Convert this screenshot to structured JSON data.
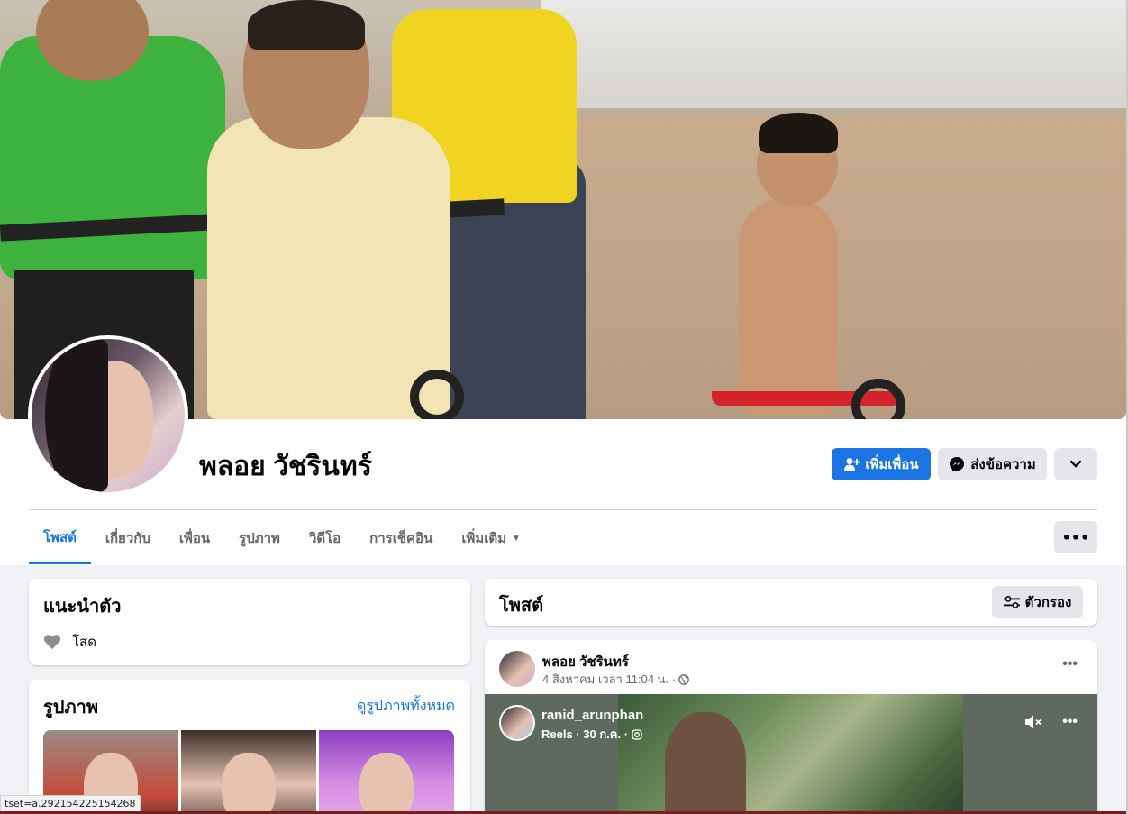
{
  "profile": {
    "name": "พลอย วัชรินทร์"
  },
  "actions": {
    "add_friend": "เพิ่มเพื่อน",
    "message": "ส่งข้อความ"
  },
  "tabs": [
    {
      "label": "โพสต์",
      "active": true
    },
    {
      "label": "เกี่ยวกับ"
    },
    {
      "label": "เพื่อน"
    },
    {
      "label": "รูปภาพ"
    },
    {
      "label": "วิดีโอ"
    },
    {
      "label": "การเช็คอิน"
    },
    {
      "label": "เพิ่มเติม"
    }
  ],
  "intro": {
    "title": "แนะนำตัว",
    "relationship": "โสด"
  },
  "photos": {
    "title": "รูปภาพ",
    "see_all": "ดูรูปภาพทั้งหมด"
  },
  "posts": {
    "title": "โพสต์",
    "filter": "ตัวกรอง"
  },
  "post": {
    "author": "พลอย วัชรินทร์",
    "timestamp": "4 สิงหาคม เวลา 11:04 น. ·",
    "reel": {
      "user": "ranid_arunphan",
      "meta": "Reels · 30 ก.ค. ·"
    }
  },
  "status_bar": "tset=a.292154225154268",
  "colors": {
    "accent": "#1b74e4",
    "secondary_button": "#e4e6eb",
    "page_bg": "#f0f2f5"
  }
}
